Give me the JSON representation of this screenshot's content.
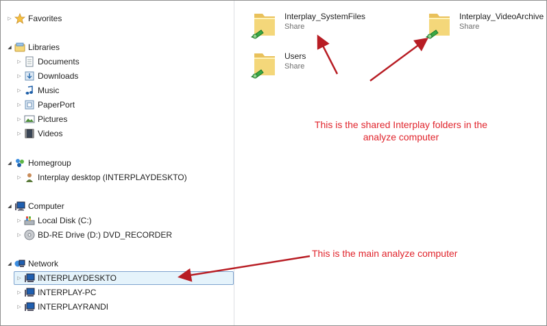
{
  "nav": {
    "favorites": "Favorites",
    "libraries": "Libraries",
    "library_items": [
      "Documents",
      "Downloads",
      "Music",
      "PaperPort",
      "Pictures",
      "Videos"
    ],
    "homegroup": "Homegroup",
    "homegroup_items": [
      "Interplay desktop (INTERPLAYDESKTO)"
    ],
    "computer": "Computer",
    "computer_items": [
      "Local Disk (C:)",
      "BD-RE Drive (D:) DVD_RECORDER"
    ],
    "network": "Network",
    "network_items": [
      "INTERPLAYDESKTO",
      "INTERPLAY-PC",
      "INTERPLAYRANDI"
    ]
  },
  "content": {
    "items": [
      {
        "name": "Interplay_SystemFiles",
        "sub": "Share"
      },
      {
        "name": "Interplay_VideoArchive",
        "sub": "Share"
      },
      {
        "name": "Users",
        "sub": "Share"
      }
    ]
  },
  "annotations": {
    "shared_line1": "This is the shared Interplay folders in the",
    "shared_line2": "analyze computer",
    "main": "This is the main analyze computer"
  },
  "colors": {
    "annotation": "#e0232b",
    "selection_bg": "#e5f3fb",
    "selection_border": "#7da2ce"
  }
}
